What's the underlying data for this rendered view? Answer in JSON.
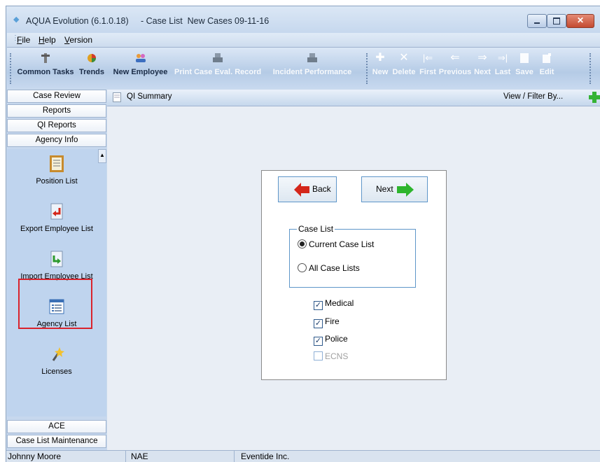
{
  "window": {
    "title": "AQUA Evolution (6.1.0.18)     - Case List  New Cases 09-11-16"
  },
  "menu": [
    {
      "label": "File",
      "accel": "F"
    },
    {
      "label": "Help",
      "accel": "H"
    },
    {
      "label": "Version",
      "accel": "V"
    }
  ],
  "toolbar": {
    "common_tasks": "Common Tasks",
    "trends": "Trends",
    "new_employee": "New Employee",
    "print_case": "Print Case Eval. Record",
    "incident_performance": "Incident Performance",
    "new": "New",
    "delete": "Delete",
    "first": "First",
    "previous": "Previous",
    "next": "Next",
    "last": "Last",
    "save": "Save",
    "edit": "Edit"
  },
  "nav": {
    "tabs_top": [
      "Case Review",
      "Reports",
      "QI Reports",
      "Agency Info"
    ],
    "items": [
      "Position List",
      "Export Employee List",
      "Import Employee List",
      "Agency List",
      "Licenses"
    ],
    "tabs_bottom": [
      "ACE",
      "Case List Maintenance"
    ]
  },
  "content_header": {
    "title": "QI Summary",
    "filter": "View / Filter By..."
  },
  "wizard": {
    "back": "Back",
    "next": "Next",
    "group_title": "Case List",
    "radio_current": "Current Case List",
    "radio_all": "All Case Lists",
    "checks": {
      "medical": "Medical",
      "fire": "Fire",
      "police": "Police",
      "ecns": "ECNS"
    }
  },
  "status": {
    "user": "Johnny Moore",
    "code": "NAE",
    "company": "Eventide Inc."
  },
  "colors": {
    "highlight_box": "#d9232d",
    "back_arrow": "#d4271b",
    "next_arrow": "#2db52d",
    "add_plus": "#35b335"
  }
}
